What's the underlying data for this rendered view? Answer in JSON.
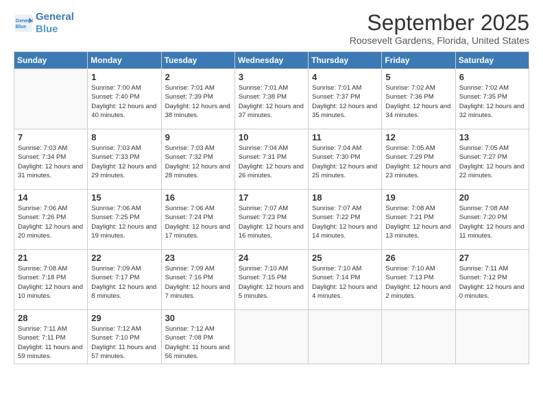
{
  "logo": {
    "line1": "General",
    "line2": "Blue"
  },
  "title": "September 2025",
  "location": "Roosevelt Gardens, Florida, United States",
  "weekdays": [
    "Sunday",
    "Monday",
    "Tuesday",
    "Wednesday",
    "Thursday",
    "Friday",
    "Saturday"
  ],
  "weeks": [
    [
      null,
      {
        "day": 1,
        "sunrise": "7:00 AM",
        "sunset": "7:40 PM",
        "daylight": "12 hours and 40 minutes."
      },
      {
        "day": 2,
        "sunrise": "7:01 AM",
        "sunset": "7:39 PM",
        "daylight": "12 hours and 38 minutes."
      },
      {
        "day": 3,
        "sunrise": "7:01 AM",
        "sunset": "7:38 PM",
        "daylight": "12 hours and 37 minutes."
      },
      {
        "day": 4,
        "sunrise": "7:01 AM",
        "sunset": "7:37 PM",
        "daylight": "12 hours and 35 minutes."
      },
      {
        "day": 5,
        "sunrise": "7:02 AM",
        "sunset": "7:36 PM",
        "daylight": "12 hours and 34 minutes."
      },
      {
        "day": 6,
        "sunrise": "7:02 AM",
        "sunset": "7:35 PM",
        "daylight": "12 hours and 32 minutes."
      }
    ],
    [
      {
        "day": 7,
        "sunrise": "7:03 AM",
        "sunset": "7:34 PM",
        "daylight": "12 hours and 31 minutes."
      },
      {
        "day": 8,
        "sunrise": "7:03 AM",
        "sunset": "7:33 PM",
        "daylight": "12 hours and 29 minutes."
      },
      {
        "day": 9,
        "sunrise": "7:03 AM",
        "sunset": "7:32 PM",
        "daylight": "12 hours and 28 minutes."
      },
      {
        "day": 10,
        "sunrise": "7:04 AM",
        "sunset": "7:31 PM",
        "daylight": "12 hours and 26 minutes."
      },
      {
        "day": 11,
        "sunrise": "7:04 AM",
        "sunset": "7:30 PM",
        "daylight": "12 hours and 25 minutes."
      },
      {
        "day": 12,
        "sunrise": "7:05 AM",
        "sunset": "7:29 PM",
        "daylight": "12 hours and 23 minutes."
      },
      {
        "day": 13,
        "sunrise": "7:05 AM",
        "sunset": "7:27 PM",
        "daylight": "12 hours and 22 minutes."
      }
    ],
    [
      {
        "day": 14,
        "sunrise": "7:06 AM",
        "sunset": "7:26 PM",
        "daylight": "12 hours and 20 minutes."
      },
      {
        "day": 15,
        "sunrise": "7:06 AM",
        "sunset": "7:25 PM",
        "daylight": "12 hours and 19 minutes."
      },
      {
        "day": 16,
        "sunrise": "7:06 AM",
        "sunset": "7:24 PM",
        "daylight": "12 hours and 17 minutes."
      },
      {
        "day": 17,
        "sunrise": "7:07 AM",
        "sunset": "7:23 PM",
        "daylight": "12 hours and 16 minutes."
      },
      {
        "day": 18,
        "sunrise": "7:07 AM",
        "sunset": "7:22 PM",
        "daylight": "12 hours and 14 minutes."
      },
      {
        "day": 19,
        "sunrise": "7:08 AM",
        "sunset": "7:21 PM",
        "daylight": "12 hours and 13 minutes."
      },
      {
        "day": 20,
        "sunrise": "7:08 AM",
        "sunset": "7:20 PM",
        "daylight": "12 hours and 11 minutes."
      }
    ],
    [
      {
        "day": 21,
        "sunrise": "7:08 AM",
        "sunset": "7:18 PM",
        "daylight": "12 hours and 10 minutes."
      },
      {
        "day": 22,
        "sunrise": "7:09 AM",
        "sunset": "7:17 PM",
        "daylight": "12 hours and 8 minutes."
      },
      {
        "day": 23,
        "sunrise": "7:09 AM",
        "sunset": "7:16 PM",
        "daylight": "12 hours and 7 minutes."
      },
      {
        "day": 24,
        "sunrise": "7:10 AM",
        "sunset": "7:15 PM",
        "daylight": "12 hours and 5 minutes."
      },
      {
        "day": 25,
        "sunrise": "7:10 AM",
        "sunset": "7:14 PM",
        "daylight": "12 hours and 4 minutes."
      },
      {
        "day": 26,
        "sunrise": "7:10 AM",
        "sunset": "7:13 PM",
        "daylight": "12 hours and 2 minutes."
      },
      {
        "day": 27,
        "sunrise": "7:11 AM",
        "sunset": "7:12 PM",
        "daylight": "12 hours and 0 minutes."
      }
    ],
    [
      {
        "day": 28,
        "sunrise": "7:11 AM",
        "sunset": "7:11 PM",
        "daylight": "11 hours and 59 minutes."
      },
      {
        "day": 29,
        "sunrise": "7:12 AM",
        "sunset": "7:10 PM",
        "daylight": "11 hours and 57 minutes."
      },
      {
        "day": 30,
        "sunrise": "7:12 AM",
        "sunset": "7:08 PM",
        "daylight": "11 hours and 56 minutes."
      },
      null,
      null,
      null,
      null
    ]
  ]
}
